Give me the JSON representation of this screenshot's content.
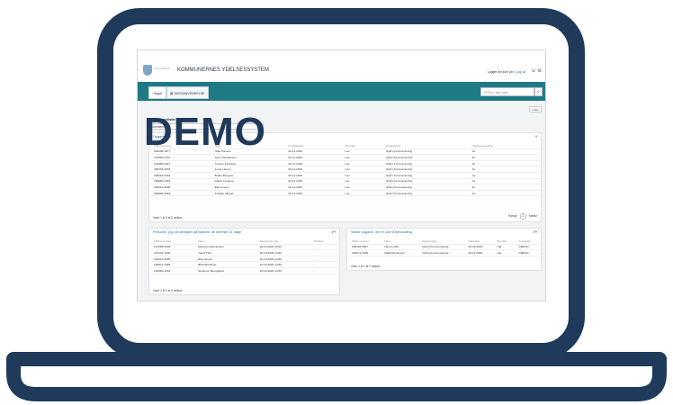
{
  "demo_label": "DEMO",
  "colors": {
    "laptop_frame": "#1f3a5a",
    "accent": "#1e7b86",
    "link": "#2c6da3"
  },
  "header": {
    "logo_text": "BALLERUP",
    "app_title": "KOMMUNERNES YDELSESSYSTEM",
    "user_text": "Logget ind som pbr |",
    "logout_label": "Log ud"
  },
  "nav": {
    "tabs": [
      {
        "label": "Sager"
      },
      {
        "label": "SAGSANVENDELSE"
      }
    ],
    "search_placeholder": "CPR-nr. eller navn"
  },
  "main": {
    "links_label": "Links",
    "task_list_label": "Dine opgavelister",
    "task_list_selected": "Kommentering"
  },
  "task_panel": {
    "title": "Opgaveliste",
    "columns": [
      "CPR-nummer",
      "Navn",
      "Forfaldsdato",
      "Prioritet",
      "Opgavetype",
      "Opgaveansvarlig"
    ],
    "rows": [
      [
        "200188-1077",
        "Gitte Hansen",
        "02-11-2020",
        "Lav",
        "Opkrv Kommentering",
        "Ja"
      ],
      [
        "270890-3761",
        "Axel Christiansen",
        "02-11-2020",
        "Lav",
        "Opkrv Kommentering",
        "Ja"
      ],
      [
        "101080-1027",
        "Torsten Fonbjerg",
        "02-11-2020",
        "Lav",
        "Opkrv Kommentering",
        "Ja"
      ],
      [
        "300494-4032",
        "Lucia Larsen",
        "02-11-2020",
        "Lav",
        "Opkrv Kommentering",
        "Ja"
      ],
      [
        "230218-4162",
        "Brahe Bergsen",
        "02-11-2020",
        "Lav",
        "Opkrv Kommentering",
        "Ja"
      ],
      [
        "150860-1023",
        "Jakob Lyngsoe",
        "02-11-2020",
        "Lav",
        "Opkrv Kommentering",
        "Ja"
      ],
      [
        "200310-4006",
        "Ella Jensen",
        "02-11-2020",
        "Lav",
        "Opkrv Kommentering",
        "Ja"
      ],
      [
        "060890-3062",
        "Kristian Albrekt",
        "02-11-2020",
        "Lav",
        "Opkrv Kommentering",
        "Ja"
      ]
    ],
    "footer": "Viser 1 til 8 af 8 rækker",
    "pager_prev": "Forrige",
    "pager_page": "1",
    "pager_next": "Næste"
  },
  "persons_panel": {
    "title": "Personer, jeg har arbejdet på indenfor de seneste 21 dage",
    "columns": [
      "CPR-nummer",
      "Navn",
      "Senest set sag",
      "Opslag"
    ],
    "rows": [
      [
        "221089-4306",
        "Rasmus Rasmussen",
        "10-10-2020 15:12",
        "-"
      ],
      [
        "221234-1230",
        "Jasmi Holt",
        "10-10-2020 14:56",
        "-"
      ],
      [
        "200310-4006",
        "Ella Jensen",
        "10-10-2020 14:56",
        "-"
      ],
      [
        "160872-1026",
        "Bifrid Bucktrup",
        "10-10-2020 14:56",
        "-"
      ],
      [
        "120990-1234",
        "Susanne Strengaard",
        "10-10-2020 14:56",
        "-"
      ]
    ],
    "footer": "Viser 1 til 5 af 5 rækker"
  },
  "cases_panel": {
    "title": "Sidste opgaver, der er klar til behandling",
    "columns": [
      "CPR-nummer",
      "Navn",
      "Opgavetype",
      "Startdato",
      "Prioritet",
      "Ansvarlig"
    ],
    "rows": [
      [
        "300118-4067",
        "Hans Lindh",
        "Opkrv Kommentering",
        "05-10-2020",
        "Høj",
        "AMKKD"
      ],
      [
        "220971-2030",
        "Malik Mortensen",
        "Opkrv Kommentering",
        "05-11-2020",
        "Lav",
        "AMKKD"
      ]
    ],
    "footer": "Viser 1 til 2 af 2 rækker"
  }
}
